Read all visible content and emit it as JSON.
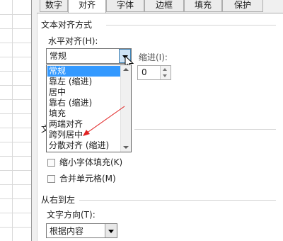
{
  "tabs": [
    {
      "label": "数字"
    },
    {
      "label": "对齐"
    },
    {
      "label": "字体"
    },
    {
      "label": "边框"
    },
    {
      "label": "填充"
    },
    {
      "label": "保护"
    }
  ],
  "active_tab": "对齐",
  "text_alignment": {
    "section_title": "文本对齐方式",
    "horizontal_label": "水平对齐(H):",
    "horizontal_value": "常规",
    "horizontal_options": [
      {
        "label": "常规",
        "selected": true
      },
      {
        "label": "靠左 (缩进)"
      },
      {
        "label": "居中"
      },
      {
        "label": "靠右 (缩进)"
      },
      {
        "label": "填充"
      },
      {
        "label": "两端对齐"
      },
      {
        "label": "跨列居中"
      },
      {
        "label": "分散对齐 (缩进)"
      }
    ],
    "indent_label": "缩进(I):",
    "indent_value": "0"
  },
  "text_control": {
    "section_title_fragment": "文",
    "shrink_to_fit": {
      "label": "缩小字体填充(K)",
      "checked": false
    },
    "merge_cells": {
      "label": "合并单元格(M)",
      "checked": false
    }
  },
  "right_to_left": {
    "section_title": "从右到左",
    "direction_label": "文字方向(T):",
    "direction_value": "根据内容"
  },
  "annotation": {
    "arrow_color": "#e02020"
  },
  "colors": {
    "selection": "#3399ff"
  }
}
